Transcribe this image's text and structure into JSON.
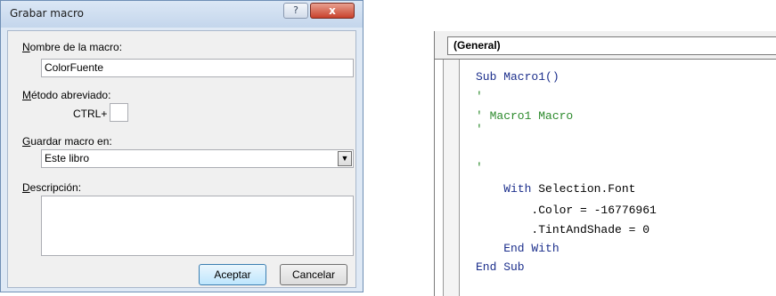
{
  "dialog": {
    "title": "Grabar macro",
    "help_button": "?",
    "close_button": "x",
    "macro_name": {
      "label_key": "N",
      "label_rest": "ombre de la macro:",
      "value": "ColorFuente"
    },
    "shortcut": {
      "label_key": "M",
      "label_rest": "étodo abreviado:",
      "prefix": "CTRL+",
      "value": ""
    },
    "store_in": {
      "label_key": "G",
      "label_rest": "uardar macro en:",
      "value": "Este libro",
      "dropdown_icon": "▼"
    },
    "description": {
      "label_key": "D",
      "label_rest": "escripción:",
      "value": ""
    },
    "ok_button": "Aceptar",
    "cancel_button": "Cancelar"
  },
  "code_window": {
    "object_combo": "(General)",
    "lines": [
      "Sub Macro1()",
      "'",
      "' Macro1 Macro",
      "'",
      "",
      "'",
      "    With Selection.Font",
      "        .Color = -16776961",
      "        .TintAndShade = 0",
      "    End With",
      "End Sub"
    ]
  },
  "colors": {
    "keyword": "#1c2f8c",
    "comment": "#2d8a2d",
    "close_button": "#c8412c"
  }
}
